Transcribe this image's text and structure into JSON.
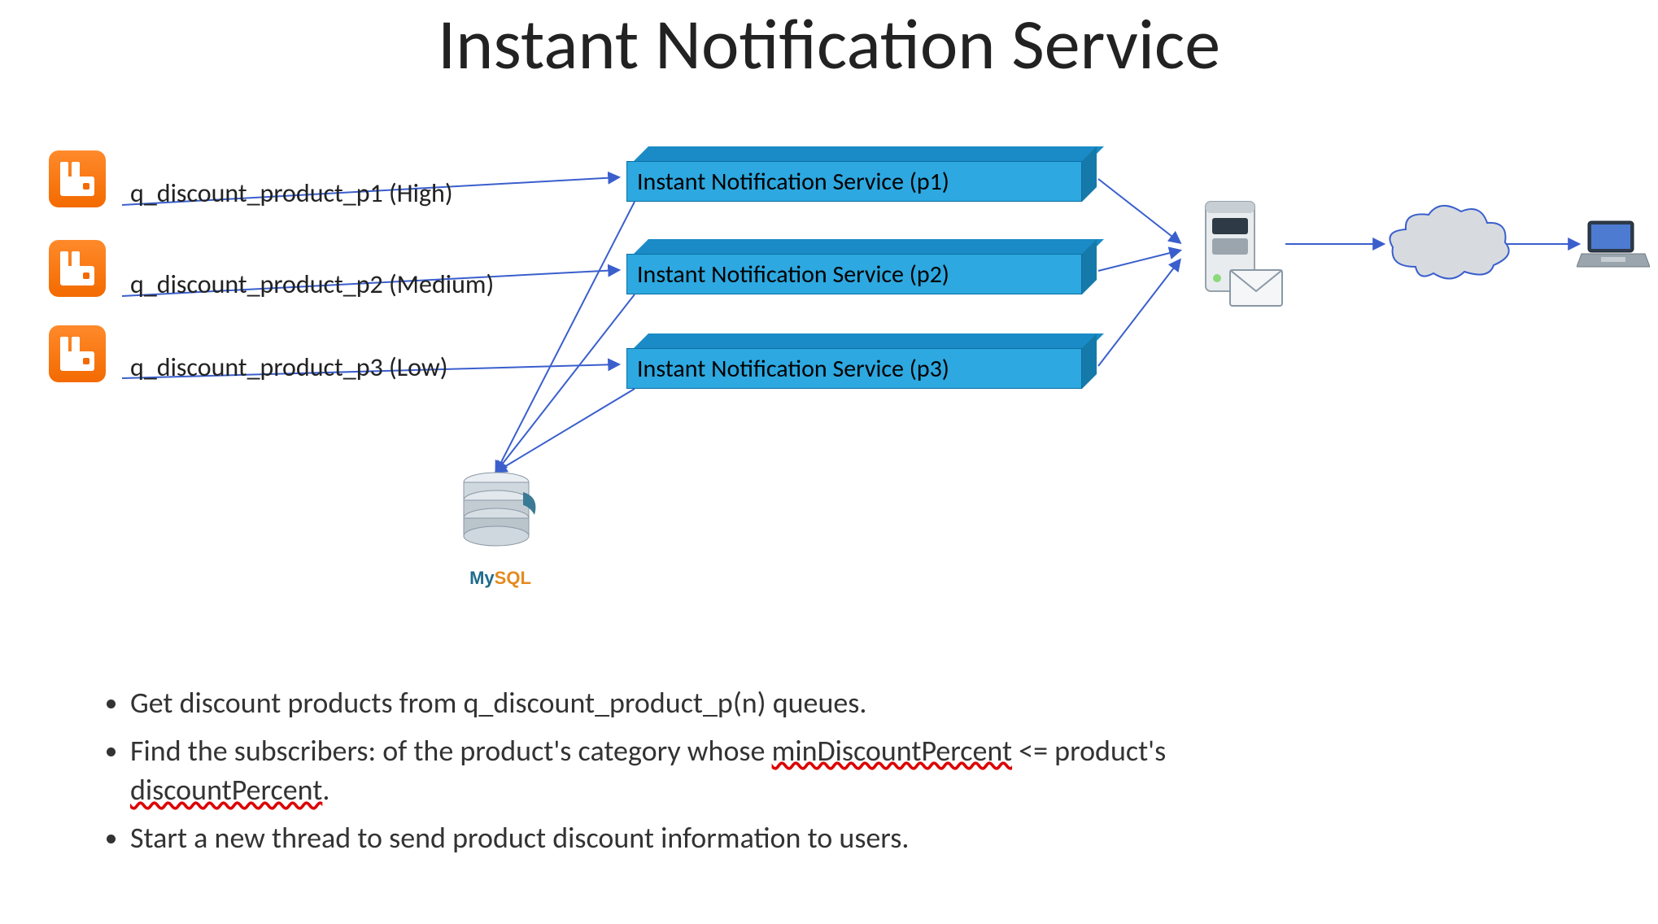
{
  "title": "Instant Notification Service",
  "queues": {
    "q1": "q_discount_product_p1 (High)",
    "q2": "q_discount_product_p2 (Medium)",
    "q3": "q_discount_product_p3 (Low)"
  },
  "services": {
    "s1": "Instant Notification Service (p1)",
    "s2": "Instant Notification Service (p2)",
    "s3": "Instant Notification Service (p3)"
  },
  "icons": {
    "db": "MySQL",
    "mail_server": "mail-server",
    "cloud": "cloud",
    "laptop": "laptop"
  },
  "bullets": {
    "b1_pre": "Get discount products from q_discount_product_p(n) queues.",
    "b2_pre": "Find the subscribers: of the product's category whose ",
    "b2_u1": "minDiscountPercent",
    "b2_mid": " <= product's ",
    "b2_u2": "discountPercent",
    "b2_post": ".",
    "b3_pre": "Start a new thread to send product discount information to users."
  }
}
